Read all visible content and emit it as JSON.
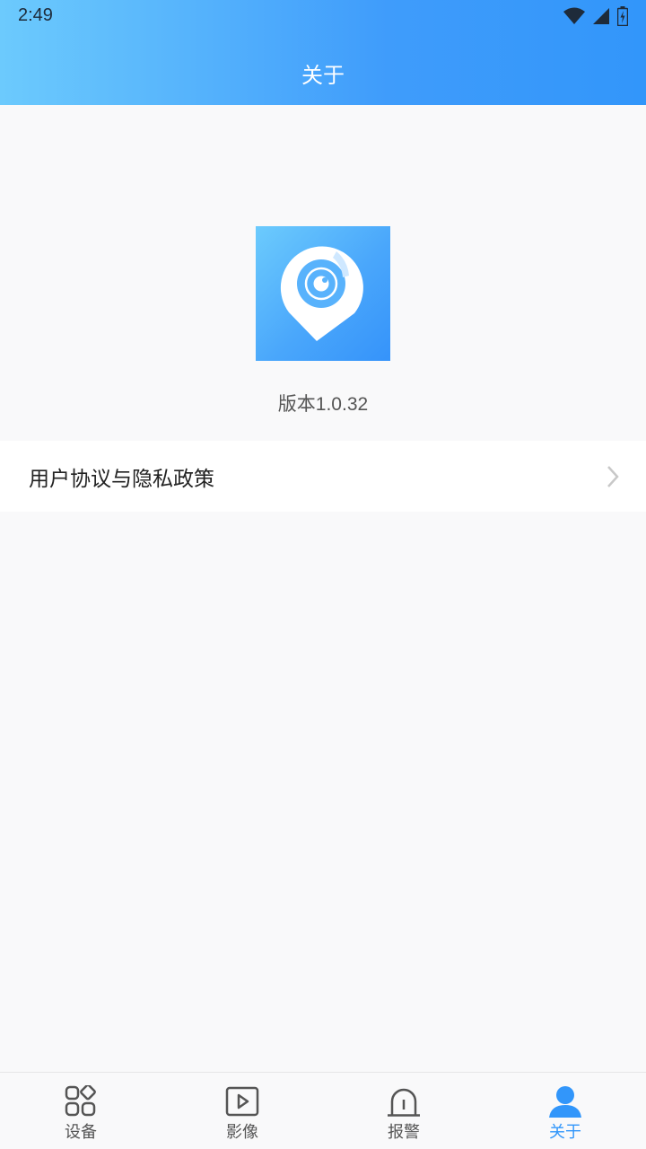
{
  "status_bar": {
    "time": "2:49"
  },
  "header": {
    "title": "关于"
  },
  "about": {
    "version": "版本1.0.32",
    "links": [
      {
        "label": "用户协议与隐私政策"
      }
    ]
  },
  "tabs": [
    {
      "label": "设备",
      "icon": "grid-icon",
      "active": false
    },
    {
      "label": "影像",
      "icon": "play-icon",
      "active": false
    },
    {
      "label": "报警",
      "icon": "alarm-icon",
      "active": false
    },
    {
      "label": "关于",
      "icon": "user-icon",
      "active": true
    }
  ],
  "colors": {
    "accent": "#3296fa",
    "header_start": "#6ccafd",
    "header_end": "#3296fa",
    "text_inactive": "#555555"
  }
}
